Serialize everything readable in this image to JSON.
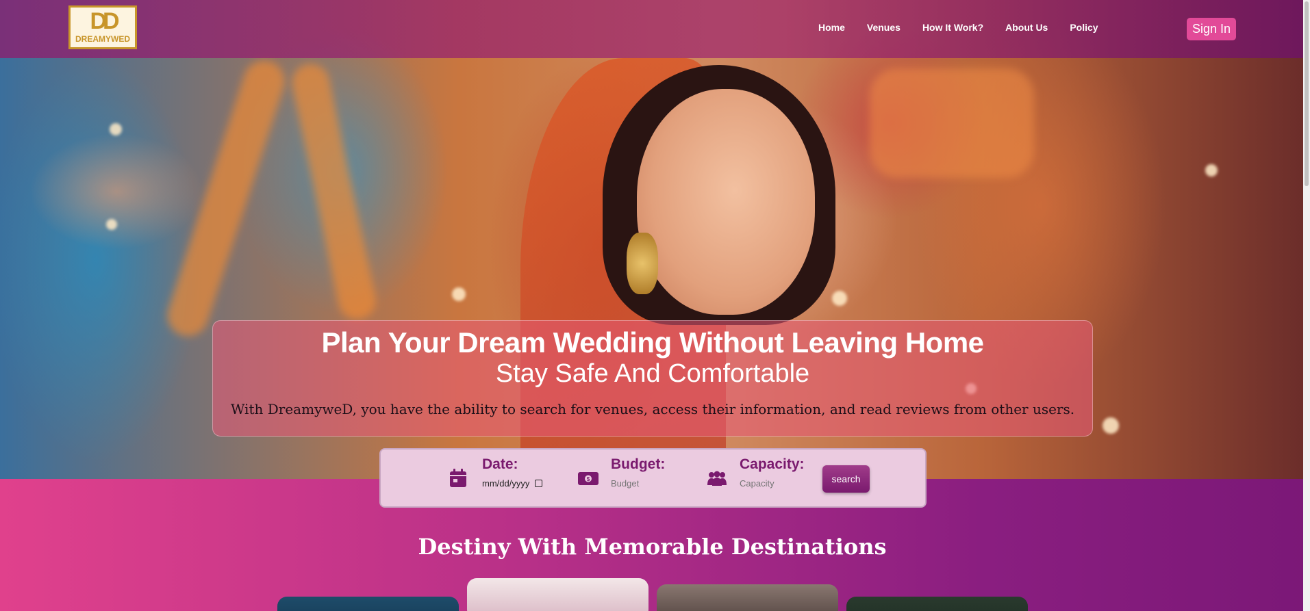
{
  "brand": {
    "logo_mark": "DD",
    "logo_text": "DREAMYWED"
  },
  "nav": {
    "links": [
      "Home",
      "Venues",
      "How It Work?",
      "About Us",
      "Policy"
    ],
    "sign_in": "Sign In"
  },
  "hero": {
    "title": "Plan Your Dream Wedding Without Leaving Home",
    "subtitle": "Stay Safe And Comfortable",
    "description": "With DreamyweD, you have the ability to search for venues, access their information, and read reviews from other users."
  },
  "search": {
    "date": {
      "label": "Date:",
      "value": "mm/dd/yyyy",
      "icon": "calendar-icon"
    },
    "budget": {
      "label": "Budget:",
      "placeholder": "Budget",
      "icon": "money-icon"
    },
    "capacity": {
      "label": "Capacity:",
      "placeholder": "Capacity",
      "icon": "people-icon"
    },
    "button": "search"
  },
  "destinations": {
    "title": "Destiny With Memorable Destinations"
  },
  "colors": {
    "primary": "#7a1a6e",
    "accent": "#e24a98",
    "logo_gold": "#c8952a"
  }
}
